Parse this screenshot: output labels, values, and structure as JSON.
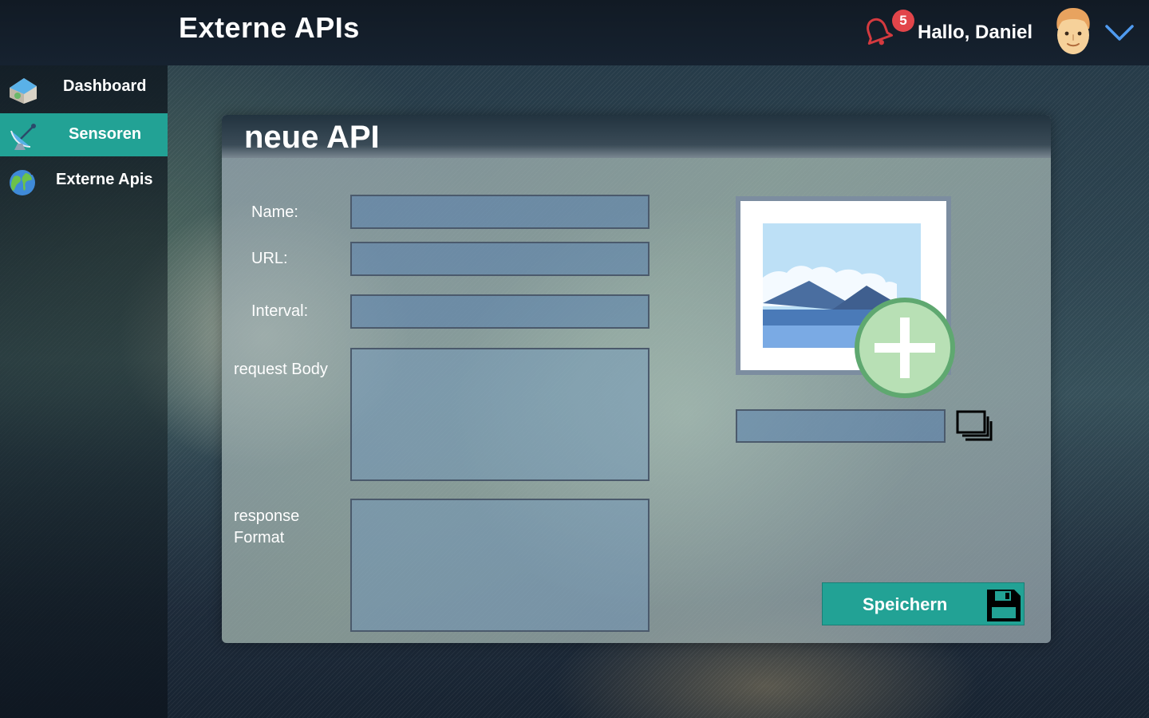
{
  "header": {
    "title": "Externe APIs",
    "notification_count": "5",
    "greeting": "Hallo, Daniel",
    "icons": [
      "bell-icon",
      "avatar",
      "chevron-down-icon"
    ]
  },
  "sidebar": {
    "items": [
      {
        "label": "Dashboard",
        "icon": "house-icon",
        "active": false
      },
      {
        "label": "Sensoren",
        "icon": "satellite-dish-icon",
        "active": true
      },
      {
        "label": "Externe Apis",
        "icon": "globe-icon",
        "active": false
      }
    ]
  },
  "form": {
    "title": "neue API",
    "fields": {
      "name": {
        "label": "Name:",
        "value": ""
      },
      "url": {
        "label": "URL:",
        "value": ""
      },
      "interval": {
        "label": "Interval:",
        "value": ""
      },
      "request_body": {
        "label": "request Body",
        "value": ""
      },
      "response_format": {
        "label": "response Format",
        "value": ""
      }
    },
    "image_path": {
      "value": ""
    },
    "save_label": "Speichern"
  },
  "colors": {
    "accent": "#22a295",
    "badge": "#e2454a",
    "bell": "#d43a3f",
    "add_button": "#b8e0b5"
  }
}
